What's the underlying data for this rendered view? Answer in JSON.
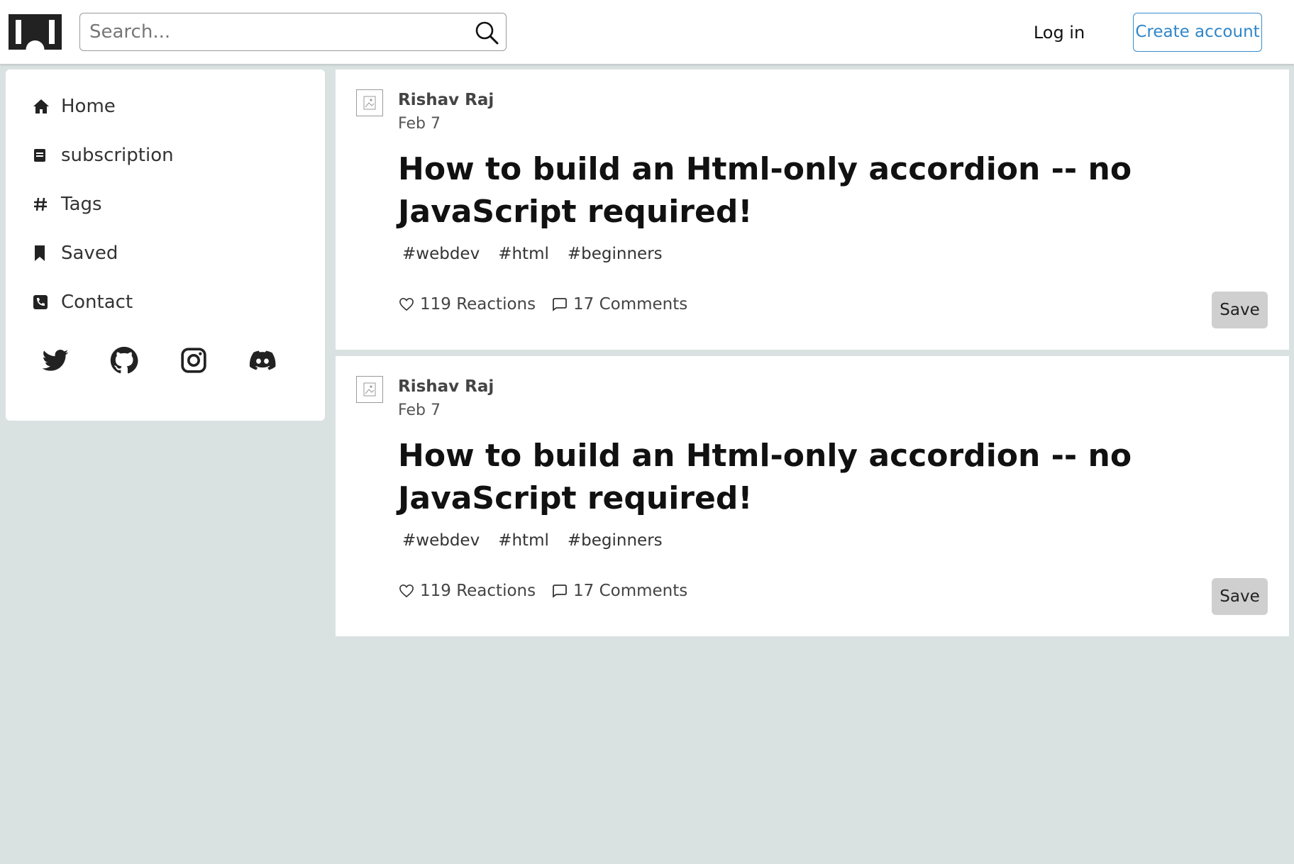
{
  "header": {
    "logo_icon": "dev-logo-icon",
    "search_placeholder": "Search...",
    "search_icon": "search-icon",
    "login_label": "Log in",
    "create_account_label": "Create account",
    "accent_color": "#2f86c8"
  },
  "sidebar": {
    "items": [
      {
        "label": "Home",
        "icon": "home-icon"
      },
      {
        "label": "subscription",
        "icon": "document-icon"
      },
      {
        "label": "Tags",
        "icon": "hash-icon"
      },
      {
        "label": "Saved",
        "icon": "bookmark-icon"
      },
      {
        "label": "Contact",
        "icon": "phone-icon"
      }
    ],
    "socials": [
      "twitter-icon",
      "github-icon",
      "instagram-icon",
      "discord-icon"
    ]
  },
  "posts": [
    {
      "author": "Rishav Raj",
      "date": "Feb 7",
      "title": "How to build an Html-only accordion -- no JavaScript required!",
      "tags": [
        "#webdev",
        "#html",
        "#beginners"
      ],
      "reactions": "119 Reactions",
      "comments": "17 Comments",
      "save_label": "Save"
    },
    {
      "author": "Rishav Raj",
      "date": "Feb 7",
      "title": "How to build an Html-only accordion -- no JavaScript required!",
      "tags": [
        "#webdev",
        "#html",
        "#beginners"
      ],
      "reactions": "119 Reactions",
      "comments": "17 Comments",
      "save_label": "Save"
    }
  ]
}
